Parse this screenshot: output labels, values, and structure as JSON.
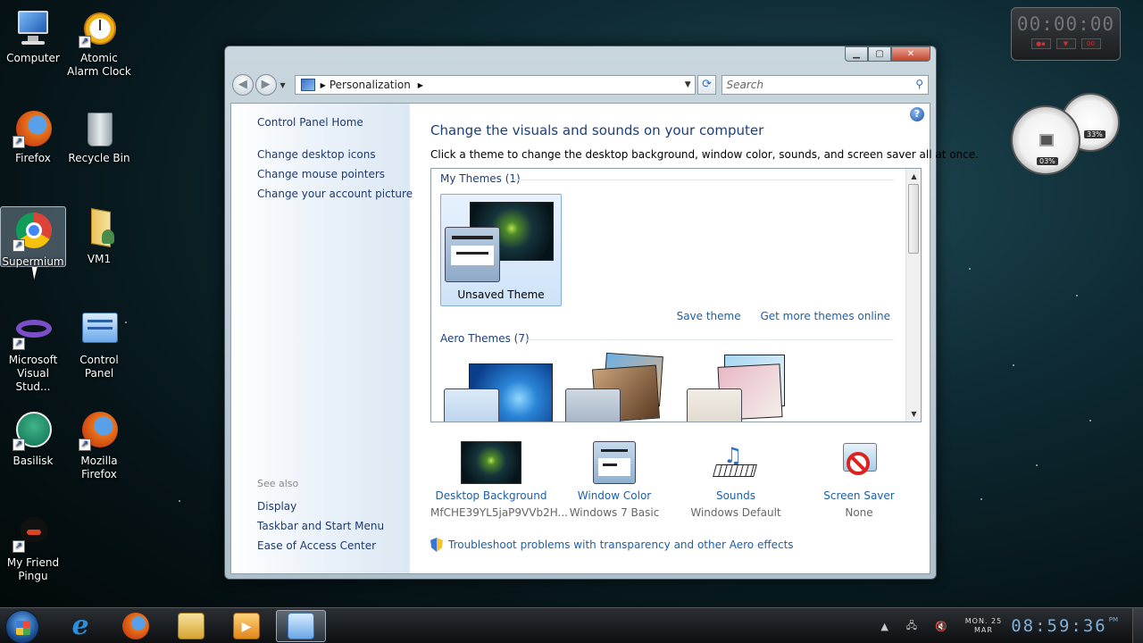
{
  "desktop": {
    "icons": [
      {
        "label": "Computer",
        "icon": "computer-icon"
      },
      {
        "label": "Atomic\nAlarm Clock",
        "icon": "alarm-clock-icon"
      },
      {
        "label": "Firefox",
        "icon": "firefox-icon"
      },
      {
        "label": "Recycle Bin",
        "icon": "recycle-bin-icon"
      },
      {
        "label": "Supermium",
        "icon": "chrome-icon"
      },
      {
        "label": "VM1",
        "icon": "folder-icon"
      },
      {
        "label": "Microsoft\nVisual Stud...",
        "icon": "visual-studio-icon"
      },
      {
        "label": "Control\nPanel",
        "icon": "control-panel-icon"
      },
      {
        "label": "Basilisk",
        "icon": "basilisk-icon"
      },
      {
        "label": "Mozilla\nFirefox",
        "icon": "firefox-icon"
      },
      {
        "label": "My Friend\nPingu",
        "icon": "pingu-icon"
      }
    ]
  },
  "gadgets": {
    "stopwatch": "00:00:00",
    "cpu_meter": {
      "cpu": "03%",
      "ram": "33%"
    }
  },
  "window": {
    "address": {
      "crumb": "Personalization"
    },
    "search_placeholder": "Search",
    "sidebar": {
      "home": "Control Panel Home",
      "links": [
        "Change desktop icons",
        "Change mouse pointers",
        "Change your account picture"
      ],
      "see_also": "See also",
      "see_also_links": [
        "Display",
        "Taskbar and Start Menu",
        "Ease of Access Center"
      ]
    },
    "main": {
      "title": "Change the visuals and sounds on your computer",
      "subtitle": "Click a theme to change the desktop background, window color, sounds, and screen saver all at once.",
      "my_themes_head": "My Themes (1)",
      "unsaved_theme": "Unsaved Theme",
      "save_theme": "Save theme",
      "get_more": "Get more themes online",
      "aero_head": "Aero Themes (7)",
      "bottom": {
        "background": {
          "label": "Desktop Background",
          "value": "MfCHE39YL5jaP9VVb2H..."
        },
        "color": {
          "label": "Window Color",
          "value": "Windows 7 Basic"
        },
        "sounds": {
          "label": "Sounds",
          "value": "Windows Default"
        },
        "saver": {
          "label": "Screen Saver",
          "value": "None"
        }
      },
      "troubleshoot": "Troubleshoot problems with transparency and other Aero effects"
    }
  },
  "taskbar": {
    "date_line1": "MON. 25",
    "date_line2": "MAR",
    "time": "08:59:36",
    "ampm": "PM"
  }
}
